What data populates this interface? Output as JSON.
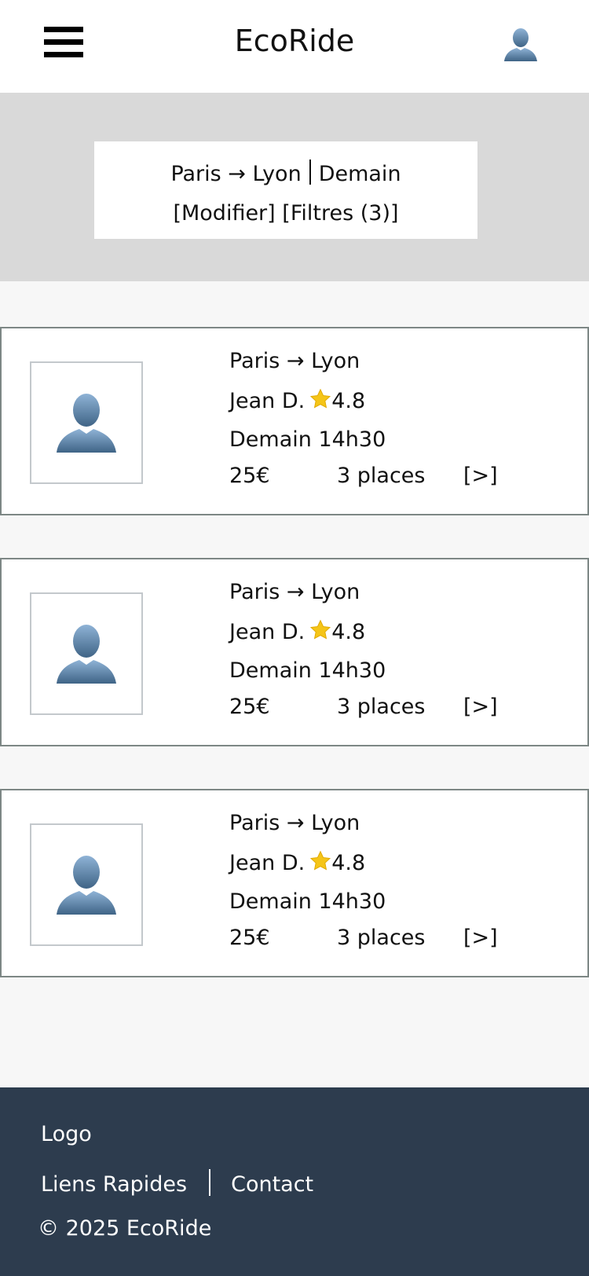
{
  "header": {
    "title": "EcoRide",
    "menu_icon": "hamburger-menu-icon",
    "profile_icon": "user-avatar-icon"
  },
  "search_summary": {
    "route": "Paris → Lyon",
    "date": "Demain",
    "modify_label": "[Modifier]",
    "filters_label": "[Filtres (3)]"
  },
  "rides": [
    {
      "route": "Paris → Lyon",
      "driver": "Jean D.",
      "rating": "4.8",
      "time": "Demain 14h30",
      "price": "25€",
      "seats": "3 places",
      "more": "[>]"
    },
    {
      "route": "Paris → Lyon",
      "driver": "Jean D.",
      "rating": "4.8",
      "time": "Demain 14h30",
      "price": "25€",
      "seats": "3 places",
      "more": "[>]"
    },
    {
      "route": "Paris → Lyon",
      "driver": "Jean D.",
      "rating": "4.8",
      "time": "Demain 14h30",
      "price": "25€",
      "seats": "3 places",
      "more": "[>]"
    }
  ],
  "footer": {
    "logo": "Logo",
    "quick_links": "Liens Rapides",
    "contact": "Contact",
    "copyright": "© 2025 EcoRide"
  },
  "colors": {
    "header_bg": "#ffffff",
    "search_band_bg": "#d9d9d9",
    "page_bg": "#f7f7f7",
    "card_border": "#7d8785",
    "footer_bg": "#2d3c4e",
    "star": "#f5c518"
  }
}
